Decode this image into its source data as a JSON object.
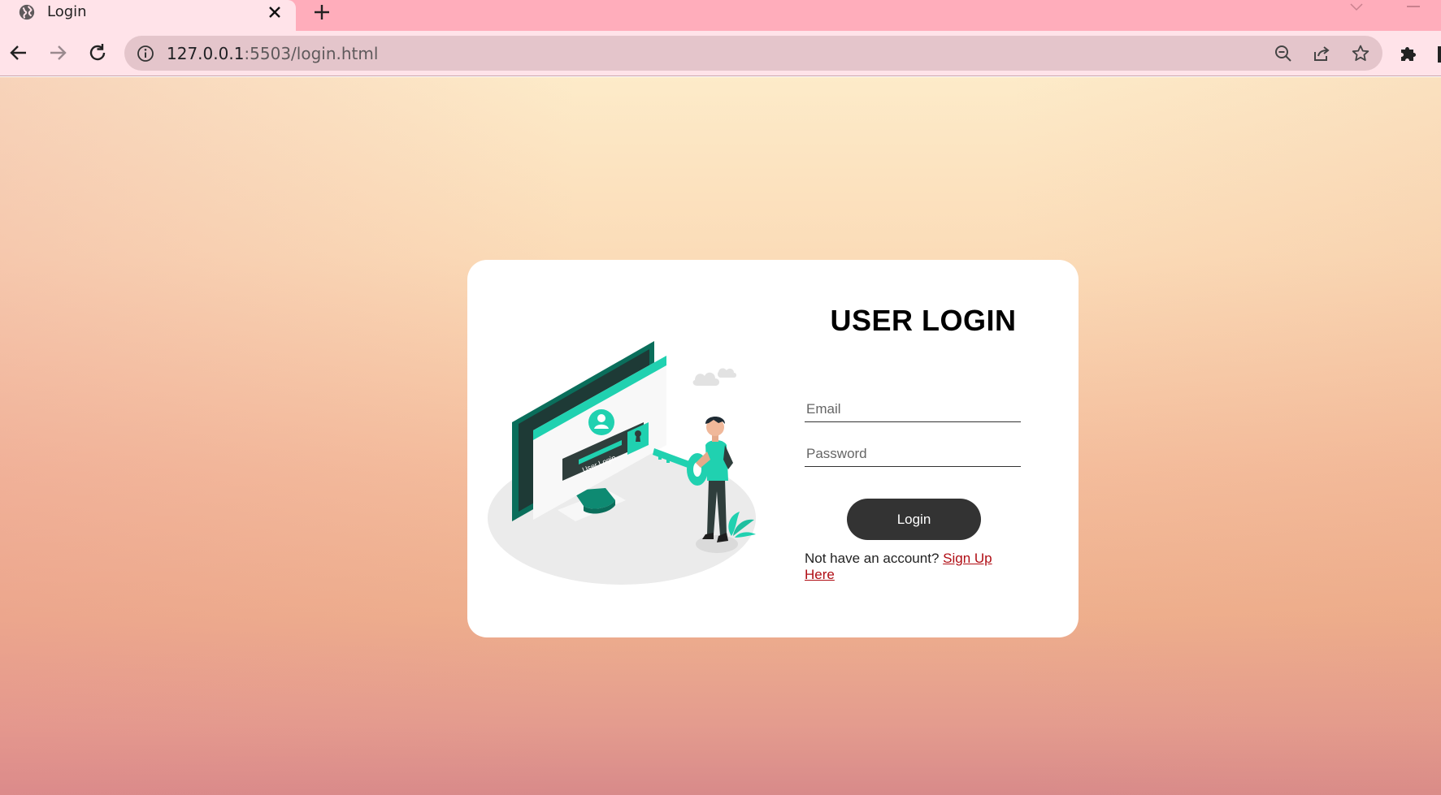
{
  "browser": {
    "tab_title": "Login",
    "url_host": "127.0.0.1",
    "url_rest": ":5503/login.html"
  },
  "colors": {
    "tabstrip": "#ffadbb",
    "toolbar": "#ffe3e9",
    "omnibox": "#e4c5cb",
    "button": "#333333",
    "link": "#b00d14"
  },
  "icons": {
    "tab_favicon": "globe-icon",
    "tab_close": "close-icon",
    "new_tab": "plus-icon",
    "back": "arrow-left-icon",
    "forward": "arrow-right-icon",
    "reload": "reload-icon",
    "site_info": "info-icon",
    "zoom": "zoom-out-icon",
    "share": "share-icon",
    "bookmark": "star-icon",
    "extensions": "puzzle-icon"
  },
  "login": {
    "title": "USER LOGIN",
    "email_placeholder": "Email",
    "password_placeholder": "Password",
    "button_label": "Login",
    "signup_prompt": "Not have an account? ",
    "signup_link": "Sign Up Here"
  }
}
